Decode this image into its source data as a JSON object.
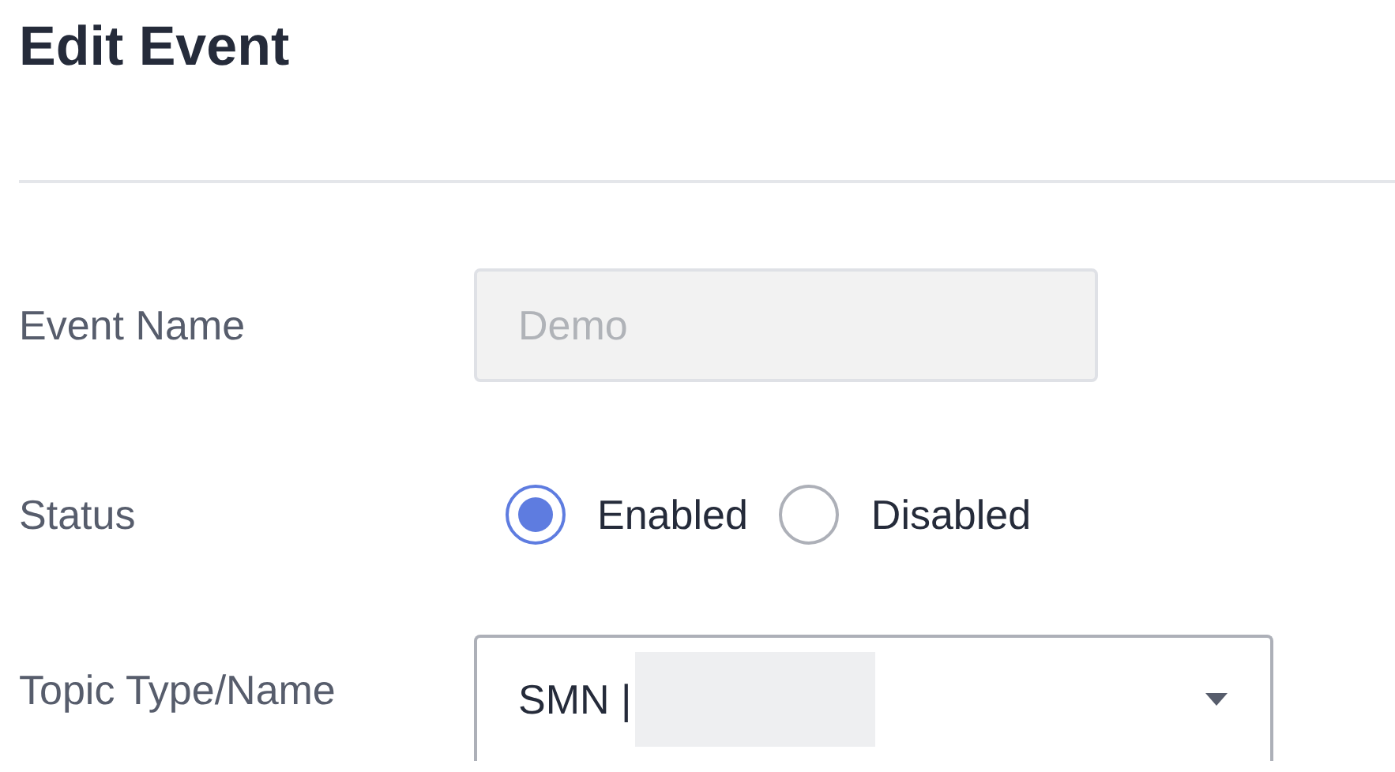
{
  "title": "Edit Event",
  "fields": [
    {
      "kind": "text",
      "label": "Event Name",
      "value": "Demo",
      "disabled": true
    },
    {
      "kind": "radio",
      "label": "Status",
      "options": [
        {
          "label": "Enabled",
          "selected": true
        },
        {
          "label": "Disabled",
          "selected": false
        }
      ]
    },
    {
      "kind": "select",
      "label": "Topic Type/Name",
      "value": "SMN |",
      "redacted": true
    }
  ]
}
